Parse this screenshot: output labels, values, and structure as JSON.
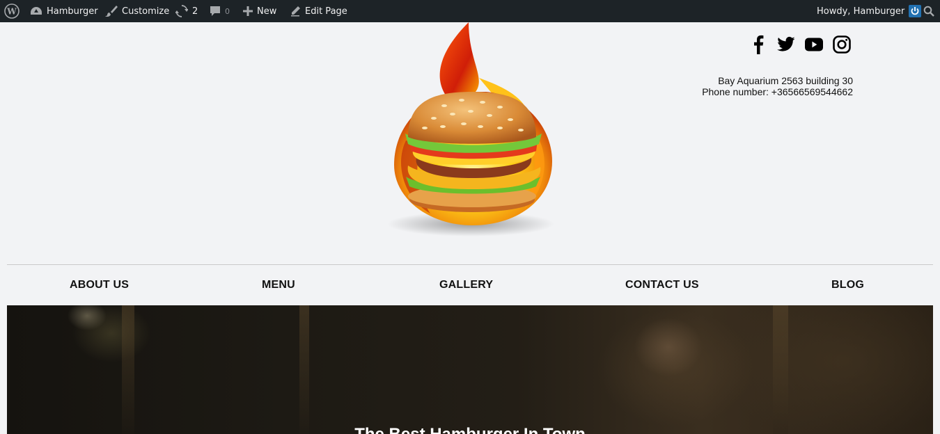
{
  "adminbar": {
    "site_name": "Hamburger",
    "customize": "Customize",
    "updates_count": "2",
    "comments_count": "0",
    "new_label": "New",
    "edit_label": "Edit Page",
    "howdy": "Howdy, Hamburger"
  },
  "header": {
    "address": "Bay Aquarium 2563 building 30",
    "phone": "Phone number: +36566569544662",
    "social": [
      "facebook",
      "twitter",
      "youtube",
      "instagram"
    ]
  },
  "nav": {
    "items": [
      "ABOUT US",
      "MENU",
      "GALLERY",
      "CONTACT US",
      "BLOG"
    ]
  },
  "hero": {
    "title": "The Best Hamburger In Town"
  },
  "colors": {
    "adminbar_bg": "#1d2327",
    "page_bg": "#f2f3f5",
    "accent": "#2271b1"
  }
}
